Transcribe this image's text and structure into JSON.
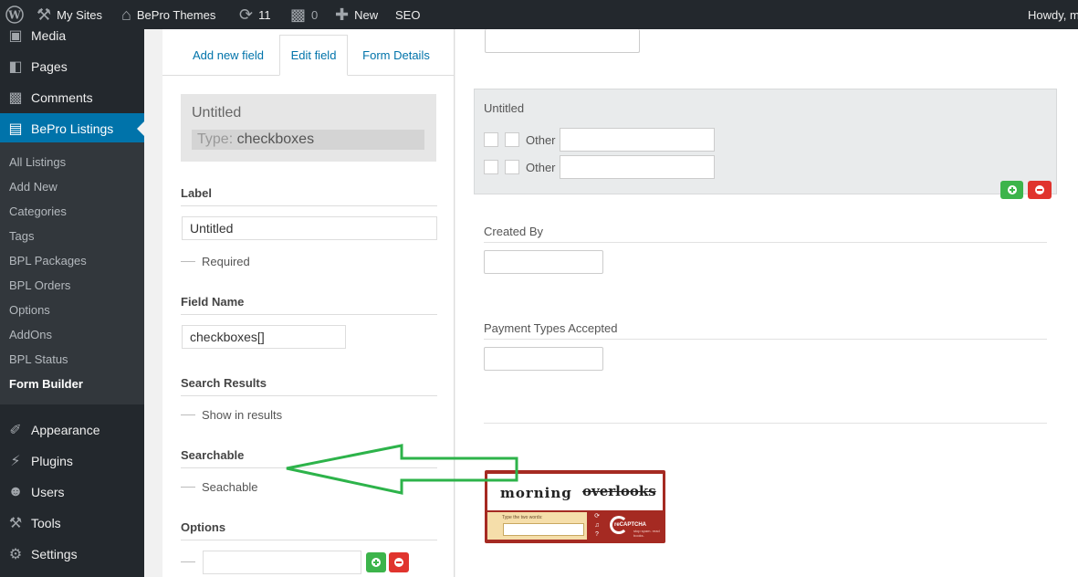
{
  "admin_bar": {
    "my_sites": "My Sites",
    "site_name": "BePro Themes",
    "updates_count": "11",
    "comments_count": "0",
    "new_label": "New",
    "seo_label": "SEO",
    "howdy": "Howdy, m",
    "icons": {
      "wp_logo": "wordpress-logo-icon",
      "my_sites": "wrench-icon",
      "site": "home-icon",
      "updates": "refresh-icon",
      "comments": "speech-bubble-icon",
      "new": "plus-icon"
    }
  },
  "sidebar": {
    "top_items": [
      {
        "label": "Media",
        "icon": "media-icon"
      },
      {
        "label": "Pages",
        "icon": "pages-icon"
      },
      {
        "label": "Comments",
        "icon": "comments-icon"
      },
      {
        "label": "BePro Listings",
        "icon": "listings-icon"
      }
    ],
    "sub_items": [
      "All Listings",
      "Add New",
      "Categories",
      "Tags",
      "BPL Packages",
      "BPL Orders",
      "Options",
      "AddOns",
      "BPL Status",
      "Form Builder"
    ],
    "current_sub": "Form Builder",
    "bottom_items": [
      {
        "label": "Appearance",
        "icon": "paintbrush-icon"
      },
      {
        "label": "Plugins",
        "icon": "plug-icon"
      },
      {
        "label": "Users",
        "icon": "user-icon"
      },
      {
        "label": "Tools",
        "icon": "wrench-icon"
      },
      {
        "label": "Settings",
        "icon": "settings-icon"
      }
    ],
    "colors": {
      "bg": "#23282d",
      "submenu_bg": "#32373c",
      "active_bg": "#0073aa"
    }
  },
  "editor": {
    "tabs": [
      "Add new field",
      "Edit field",
      "Form Details"
    ],
    "active_tab": "Edit field",
    "card_title": "Untitled",
    "card_type_prefix": "Type: ",
    "card_type_value": "checkboxes",
    "label_heading": "Label",
    "label_value": "Untitled",
    "required_label": "Required",
    "field_name_heading": "Field Name",
    "field_name_value": "checkboxes[]",
    "search_results_heading": "Search Results",
    "show_in_results_label": "Show in results",
    "searchable_heading": "Searchable",
    "searchable_label": "Seachable",
    "options_heading": "Options",
    "option_value": ""
  },
  "preview": {
    "card_title": "Untitled",
    "options": [
      {
        "label": "Other",
        "value": ""
      },
      {
        "label": "Other",
        "value": ""
      }
    ],
    "fields": [
      {
        "label": "Created By",
        "value": ""
      },
      {
        "label": "Payment Types Accepted",
        "value": ""
      }
    ],
    "captcha": {
      "word1": "morning",
      "word2": "overlooks",
      "prompt": "Type the two words:",
      "brand": "reCAPTCHA",
      "tagline": "stop spam. read books."
    }
  },
  "colors": {
    "accent": "#0073aa",
    "add_button": "#3cb44b",
    "remove_button": "#e0342e",
    "annotation_arrow": "#2db34a"
  }
}
